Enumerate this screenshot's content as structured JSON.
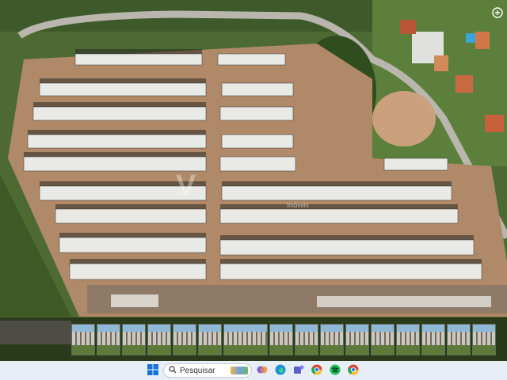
{
  "viewer": {
    "watermark_logo": "V",
    "watermark_text": "Imóveis",
    "zoom_icon": "zoom-in-icon"
  },
  "thumbnails": {
    "count": 17,
    "items": [
      "thumb",
      "thumb",
      "thumb",
      "thumb",
      "thumb",
      "thumb",
      "thumb",
      "thumb",
      "thumb",
      "thumb",
      "thumb",
      "thumb",
      "thumb",
      "thumb",
      "thumb",
      "thumb",
      "thumb"
    ]
  },
  "taskbar": {
    "start_icon": "windows-start-icon",
    "search_label": "Pesquisar",
    "search_icon": "search-icon",
    "apps": [
      {
        "name": "copilot-icon",
        "color": "#7a5cf0"
      },
      {
        "name": "edge-icon",
        "color": "#1f8fd8"
      },
      {
        "name": "teams-icon",
        "color": "#5b5fc7"
      },
      {
        "name": "chrome-icon",
        "color": "#e0433a"
      },
      {
        "name": "spotify-icon",
        "color": "#1db954"
      },
      {
        "name": "chrome-profile-icon",
        "color": "#e0433a"
      }
    ]
  },
  "colors": {
    "taskbar_bg": "#e8eef6",
    "soil": "#b08a68",
    "roof": "#e9e9e6",
    "vegetation": "#3f5f2a"
  }
}
